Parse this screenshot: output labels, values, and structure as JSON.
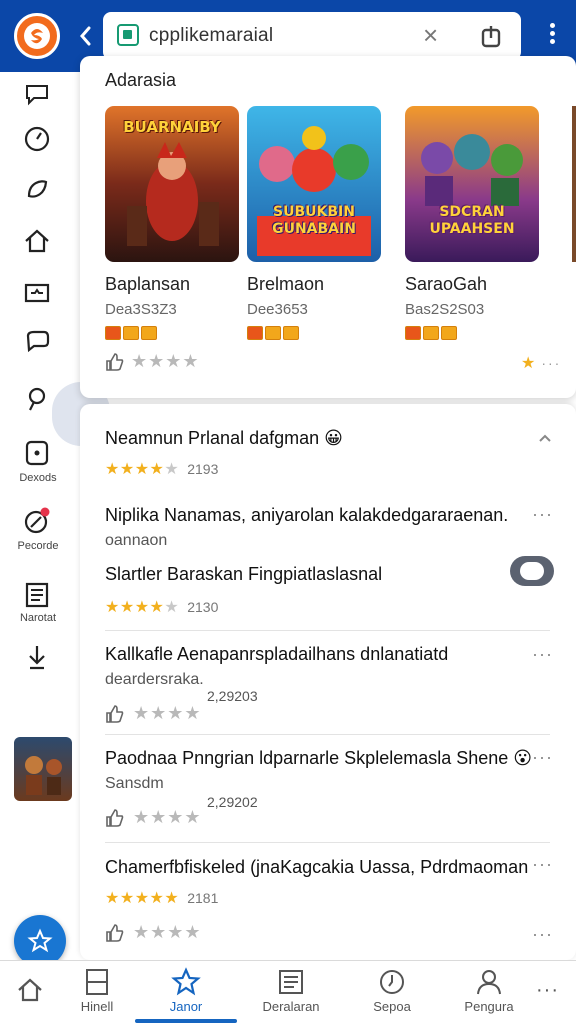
{
  "browser": {
    "url": "cpplikemaraial",
    "back_icon": "chevron-left-icon",
    "close_icon": "close-icon",
    "share_icon": "share-icon",
    "menu_icon": "kebab-menu-icon"
  },
  "colors": {
    "topbar": "#0b47a8",
    "logo": "#f26b1d",
    "accent": "#1565c0",
    "star": "#f2b01e"
  },
  "sidebar": {
    "items": [
      {
        "icon": "message-icon",
        "label": ""
      },
      {
        "icon": "clock-icon",
        "label": ""
      },
      {
        "icon": "leaf-icon",
        "label": ""
      },
      {
        "icon": "home-icon",
        "label": ""
      },
      {
        "icon": "inbox-icon",
        "label": ""
      },
      {
        "icon": "chat-icon",
        "label": ""
      },
      {
        "icon": "pin-icon",
        "label": ""
      },
      {
        "icon": "square-icon",
        "label": "Dexods"
      },
      {
        "icon": "notification-icon",
        "label": "Pecorde"
      },
      {
        "icon": "document-icon",
        "label": "Narotat"
      },
      {
        "icon": "download-icon",
        "label": ""
      }
    ]
  },
  "featured": {
    "title": "Adarasia",
    "games": [
      {
        "art_text": "BUARNAIBY",
        "title": "Baplansan",
        "sub": "Dea3S3Z3"
      },
      {
        "art_text": "SUBUKBIN GUNABAIN",
        "title": "Brelmaon",
        "sub": "Dee3653"
      },
      {
        "art_text": "SDCRAN UPAAHSEN",
        "title": "SaraoGah",
        "sub": "Bas2S2S03"
      }
    ]
  },
  "list": [
    {
      "title": "Neamnun Prlanal dafgman",
      "emoji": "😀",
      "rating": 4,
      "count": "2193",
      "sub": "",
      "date": ""
    },
    {
      "title": "Niplika Nanamas, aniyarolan kalakdedgararaenan.",
      "sub": "oannaon",
      "rating": null,
      "count": "",
      "date": ""
    },
    {
      "title": "Slartler Baraskan Fingpiatlaslasnal",
      "sub": "",
      "rating": 4,
      "count": "2130",
      "date": ""
    },
    {
      "title": "Kallkafle Aenapanrspladailhans dnlanatiatd",
      "sub": "deardersraka.",
      "rating": 0,
      "count": "",
      "date": "2,29203"
    },
    {
      "title": "Paodnaa Pnngrian ldparnarle Skplelemasla Shene",
      "emoji": "😮",
      "sub": "Sansdm",
      "rating": 0,
      "count": "",
      "date": "2,29202"
    },
    {
      "title": "Chamerfbfiskeled (jnaKagcakia Uassa, Pdrdmaoman",
      "sub": "",
      "rating": 5,
      "count": "2181",
      "date": ""
    }
  ],
  "bottom_nav": [
    {
      "icon": "home-icon",
      "label": ""
    },
    {
      "icon": "tablet-icon",
      "label": "Hinell"
    },
    {
      "icon": "star-icon",
      "label": "Janor"
    },
    {
      "icon": "news-icon",
      "label": "Deralaran"
    },
    {
      "icon": "clock-icon",
      "label": "Sepoa"
    },
    {
      "icon": "person-icon",
      "label": "Pengura"
    }
  ]
}
